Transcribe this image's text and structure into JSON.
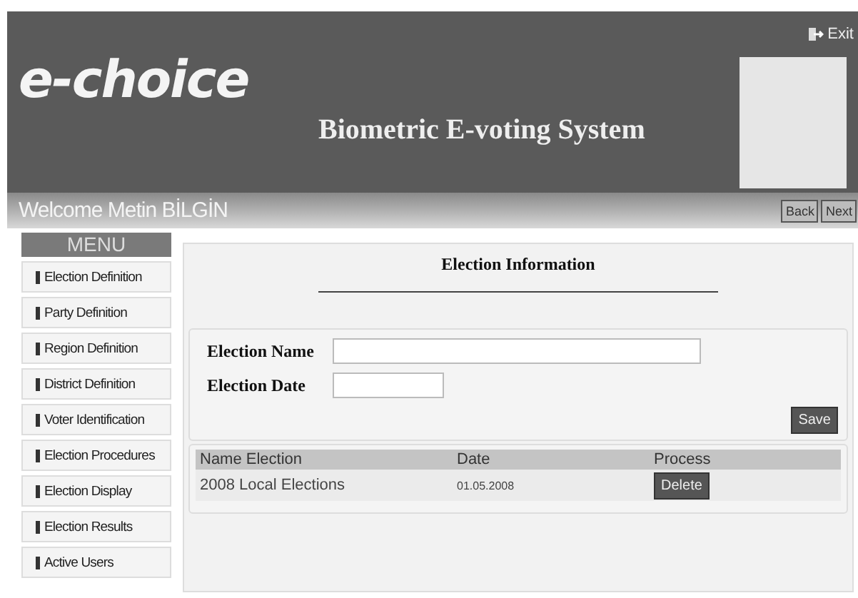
{
  "header": {
    "logo": "e-choice",
    "title": "Biometric E-voting System",
    "exit_link": "Exit"
  },
  "welcome_bar": {
    "text": "Welcome Metin BİLGİN",
    "buttons": [
      "Back",
      "Next"
    ]
  },
  "menu": {
    "title": "MENU",
    "items": [
      "Election Definition",
      "Party Definition",
      "Region Definition",
      "District Definition",
      "Voter Identification",
      "Election Procedures",
      "Election Display",
      "Election Results",
      "Active Users"
    ]
  },
  "panel": {
    "title": "Election Information",
    "form": {
      "fields": [
        {
          "label": "Election Name",
          "kind": "wide"
        },
        {
          "label": "Election Date",
          "kind": "short"
        }
      ],
      "save_button": "Save"
    },
    "table": {
      "columns": [
        "Name Election",
        "Date",
        "Process"
      ],
      "rows": [
        {
          "name": "2008 Local Elections",
          "date": "01.05.2008",
          "action": "Delete"
        }
      ]
    }
  }
}
